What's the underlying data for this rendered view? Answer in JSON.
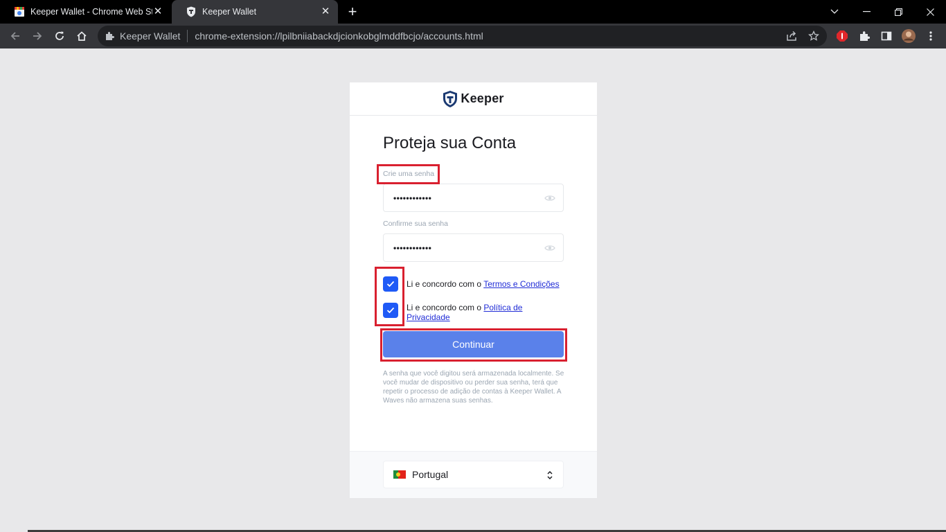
{
  "browser": {
    "tabs": [
      {
        "title": "Keeper Wallet - Chrome Web Store",
        "active": false
      },
      {
        "title": "Keeper Wallet",
        "active": true
      }
    ],
    "new_tab_symbol": "+",
    "omnibox": {
      "extension_name": "Keeper Wallet",
      "url": "chrome-extension://lpilbniiabackdjcionkobglmddfbcjo/accounts.html"
    }
  },
  "app": {
    "logo_text": "Keeper",
    "heading": "Proteja sua Conta",
    "password": {
      "label": "Crie uma senha",
      "value": "••••••••••••"
    },
    "confirm": {
      "label": "Confirme sua senha",
      "value": "••••••••••••"
    },
    "terms": {
      "checked": true,
      "prefix": "Li e concordo com o ",
      "link": "Termos e Condições"
    },
    "privacy": {
      "checked": true,
      "prefix": "Li e concordo com o ",
      "link": "Política de Privacidade"
    },
    "continue_label": "Continuar",
    "note": "A senha que você digitou será armazenada localmente. Se você mudar de dispositivo ou perder sua senha, terá que repetir o processo de adição de contas à Keeper Wallet. A Waves não armazena suas senhas.",
    "language": {
      "selected": "Portugal",
      "flag": "portugal-flag"
    }
  },
  "colors": {
    "primary": "#1f5af6",
    "button": "#5a81ea",
    "highlight": "#d9202f",
    "page_bg": "#e8e8ea"
  }
}
